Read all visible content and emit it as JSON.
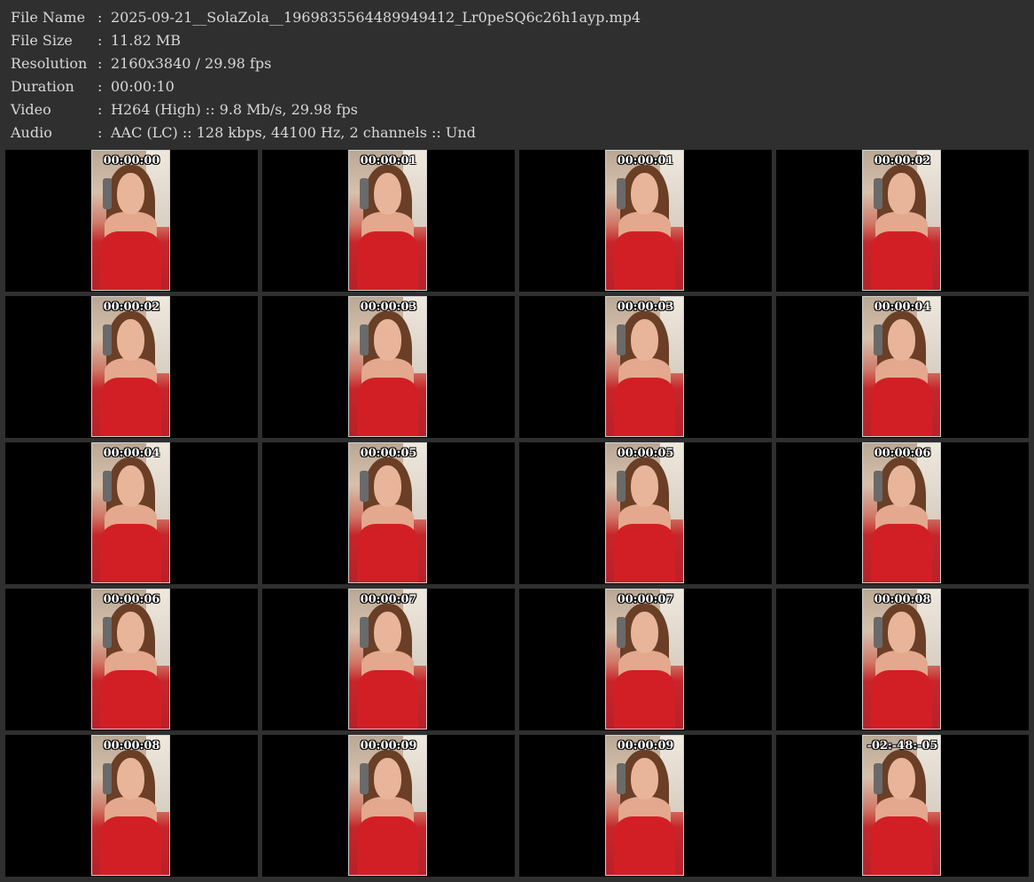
{
  "info": [
    {
      "label": "File Name",
      "value": "2025-09-21__SolaZola__1969835564489949412_Lr0peSQ6c26h1ayp.mp4"
    },
    {
      "label": "File Size",
      "value": "11.82 MB"
    },
    {
      "label": "Resolution",
      "value": "2160x3840 / 29.98 fps"
    },
    {
      "label": "Duration",
      "value": "00:00:10"
    },
    {
      "label": "Video",
      "value": "H264 (High) :: 9.8 Mb/s, 29.98 fps"
    },
    {
      "label": "Audio",
      "value": "AAC (LC) :: 128 kbps, 44100 Hz, 2 channels :: Und"
    }
  ],
  "separator": ":",
  "thumbnails": [
    "00:00:00",
    "00:00:01",
    "00:00:01",
    "00:00:02",
    "00:00:02",
    "00:00:03",
    "00:00:03",
    "00:00:04",
    "00:00:04",
    "00:00:05",
    "00:00:05",
    "00:00:06",
    "00:00:06",
    "00:00:07",
    "00:00:07",
    "00:00:08",
    "00:00:08",
    "00:00:09",
    "00:00:09",
    "-02:-48:-05"
  ],
  "colors": {
    "background": "#2f2f2f",
    "cell": "#000000",
    "text": "#d8d8d8",
    "timestamp": "#ffffff"
  }
}
